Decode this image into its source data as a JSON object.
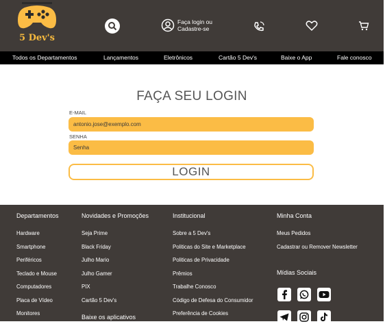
{
  "brand": {
    "name": "5 Dev's",
    "accent": "#fbbc45",
    "header_bg": "#403b38"
  },
  "header": {
    "login_line1": "Faça login ou",
    "login_line2": "Cadastre-se",
    "icons": [
      "search-icon",
      "user-icon",
      "phone-icon",
      "heart-icon",
      "cart-icon"
    ]
  },
  "nav": {
    "items": [
      "Todos os Departamentos",
      "Lançamentos",
      "Eletrônicos",
      "Cartão 5 Dev's",
      "Baixe o App",
      "Fale conosco"
    ]
  },
  "login": {
    "title": "FAÇA SEU LOGIN",
    "email_label": "E-MAIL",
    "email_value": "antonio.jose@exemplo.com",
    "password_label": "SENHA",
    "password_placeholder": "Senha",
    "button": "LOGIN"
  },
  "footer": {
    "departamentos": {
      "title": "Departamentos",
      "links": [
        "Hardware",
        "Smartphone",
        "Periféricos",
        "Teclado e Mouse",
        "Computadores",
        "Placa de Vídeo",
        "Monitores"
      ]
    },
    "novidades": {
      "title": "Novidades e Promoções",
      "links": [
        "Seja Prime",
        "Black Friday",
        "Julho Mario",
        "Julho Gamer",
        "PIX",
        "Cartão 5 Dev's",
        "Baixe os aplicativos"
      ]
    },
    "institucional": {
      "title": "Institucional",
      "links": [
        "Sobre a 5 Dev's",
        "Politicas do Site e Marketplace",
        "Politicas de Privacidade",
        "Prêmios",
        "Trabalhe Conosco",
        "Código de Defesa do Consumidor",
        "Preferência de Cookies"
      ]
    },
    "minha_conta": {
      "title": "Minha Conta",
      "links": [
        "Meus Pedidos",
        "Cadastrar ou Remover Newsletter"
      ]
    },
    "midias": {
      "title": "Mídias Sociais",
      "icons": [
        "facebook-icon",
        "whatsapp-icon",
        "youtube-icon",
        "telegram-icon",
        "instagram-icon",
        "tiktok-icon"
      ]
    }
  }
}
